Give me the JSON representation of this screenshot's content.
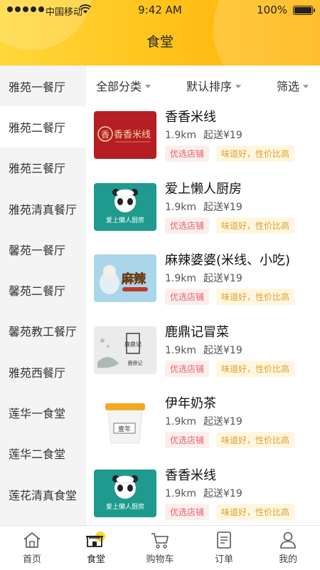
{
  "status": {
    "carrier": "中国移动",
    "time": "9:42 AM",
    "battery": "100%"
  },
  "header": {
    "title": "食堂"
  },
  "sidebar": {
    "items": [
      {
        "label": "雅苑一餐厅"
      },
      {
        "label": "雅苑二餐厅"
      },
      {
        "label": "雅苑三餐厅"
      },
      {
        "label": "雅苑清真餐厅"
      },
      {
        "label": "馨苑一餐厅"
      },
      {
        "label": "馨苑二餐厅"
      },
      {
        "label": "馨苑教工餐厅"
      },
      {
        "label": "雅苑西餐厅"
      },
      {
        "label": "莲华一食堂"
      },
      {
        "label": "莲华二食堂"
      },
      {
        "label": "莲花清真食堂"
      }
    ],
    "active_index": 1
  },
  "filters": {
    "category": "全部分类",
    "sort": "默认排序",
    "filter": "筛选"
  },
  "shops": [
    {
      "name": "香香米线",
      "distance": "1.9km",
      "min_order": "起送¥19",
      "tag1": "优选店铺",
      "tag2": "味道好，性价比高",
      "image_text": "香香米线",
      "image_style": "red-logo"
    },
    {
      "name": "爱上懒人厨房",
      "distance": "1.9km",
      "min_order": "起送¥19",
      "tag1": "优选店铺",
      "tag2": "味道好，性价比高",
      "image_text": "爱上懒人厨房",
      "image_style": "panda"
    },
    {
      "name": "麻辣婆婆(米线、小吃)",
      "distance": "1.9km",
      "min_order": "起送¥19",
      "tag1": "优选店铺",
      "tag2": "味道好，性价比高",
      "image_text": "麻辣",
      "image_style": "spicy"
    },
    {
      "name": "鹿鼎记冒菜",
      "distance": "1.9km",
      "min_order": "起送¥19",
      "tag1": "优选店铺",
      "tag2": "味道好，性价比高",
      "image_text": "鹿鼎记",
      "image_style": "ink"
    },
    {
      "name": "伊年奶茶",
      "distance": "1.9km",
      "min_order": "起送¥19",
      "tag1": "优选店铺",
      "tag2": "味道好，性价比高",
      "image_text": "壹年",
      "image_style": "cup"
    },
    {
      "name": "香香米线",
      "distance": "1.9km",
      "min_order": "起送¥19",
      "tag1": "优选店铺",
      "tag2": "味道好，性价比高",
      "image_text": "爱上懒人厨房",
      "image_style": "panda"
    }
  ],
  "tabbar": {
    "items": [
      {
        "label": "首页",
        "icon": "home-icon"
      },
      {
        "label": "食堂",
        "icon": "canteen-icon"
      },
      {
        "label": "购物车",
        "icon": "cart-icon"
      },
      {
        "label": "订单",
        "icon": "order-icon"
      },
      {
        "label": "我的",
        "icon": "profile-icon"
      }
    ]
  },
  "colors": {
    "accent": "#ffc61a",
    "tag_red": "#e8636a",
    "tag_yellow": "#e0a132"
  }
}
